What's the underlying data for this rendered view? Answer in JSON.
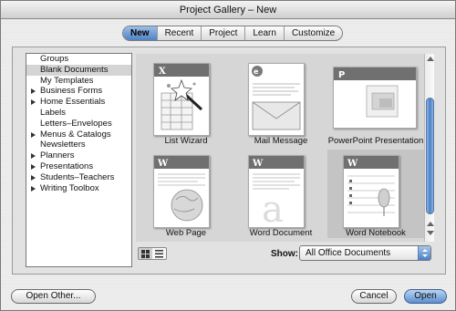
{
  "window": {
    "title": "Project Gallery – New"
  },
  "tabs": [
    {
      "label": "New",
      "active": true
    },
    {
      "label": "Recent",
      "active": false
    },
    {
      "label": "Project",
      "active": false
    },
    {
      "label": "Learn",
      "active": false
    },
    {
      "label": "Customize",
      "active": false
    }
  ],
  "sidebar": {
    "items": [
      {
        "label": "Groups",
        "expandable": false,
        "selected": false
      },
      {
        "label": "Blank Documents",
        "expandable": false,
        "selected": true
      },
      {
        "label": "My Templates",
        "expandable": false,
        "selected": false
      },
      {
        "label": "Business Forms",
        "expandable": true,
        "selected": false
      },
      {
        "label": "Home Essentials",
        "expandable": true,
        "selected": false
      },
      {
        "label": "Labels",
        "expandable": false,
        "selected": false
      },
      {
        "label": "Letters–Envelopes",
        "expandable": false,
        "selected": false
      },
      {
        "label": "Menus & Catalogs",
        "expandable": true,
        "selected": false
      },
      {
        "label": "Newsletters",
        "expandable": false,
        "selected": false
      },
      {
        "label": "Planners",
        "expandable": true,
        "selected": false
      },
      {
        "label": "Presentations",
        "expandable": true,
        "selected": false
      },
      {
        "label": "Students–Teachers",
        "expandable": true,
        "selected": false
      },
      {
        "label": "Writing Toolbox",
        "expandable": true,
        "selected": false
      }
    ]
  },
  "gallery": {
    "items": [
      {
        "label": "List Wizard",
        "icon": "list-wizard-icon",
        "selected": false
      },
      {
        "label": "Mail Message",
        "icon": "mail-message-icon",
        "selected": false
      },
      {
        "label": "PowerPoint Presentation",
        "icon": "powerpoint-icon",
        "selected": false
      },
      {
        "label": "Web Page",
        "icon": "web-page-icon",
        "selected": false
      },
      {
        "label": "Word Document",
        "icon": "word-document-icon",
        "selected": false
      },
      {
        "label": "Word Notebook",
        "icon": "word-notebook-icon",
        "selected": true
      }
    ]
  },
  "show": {
    "label": "Show:",
    "value": "All Office Documents"
  },
  "buttons": {
    "open_other": "Open Other...",
    "cancel": "Cancel",
    "open": "Open"
  },
  "colors": {
    "accent": "#4f82c4",
    "selection": "#c4c4c4"
  }
}
